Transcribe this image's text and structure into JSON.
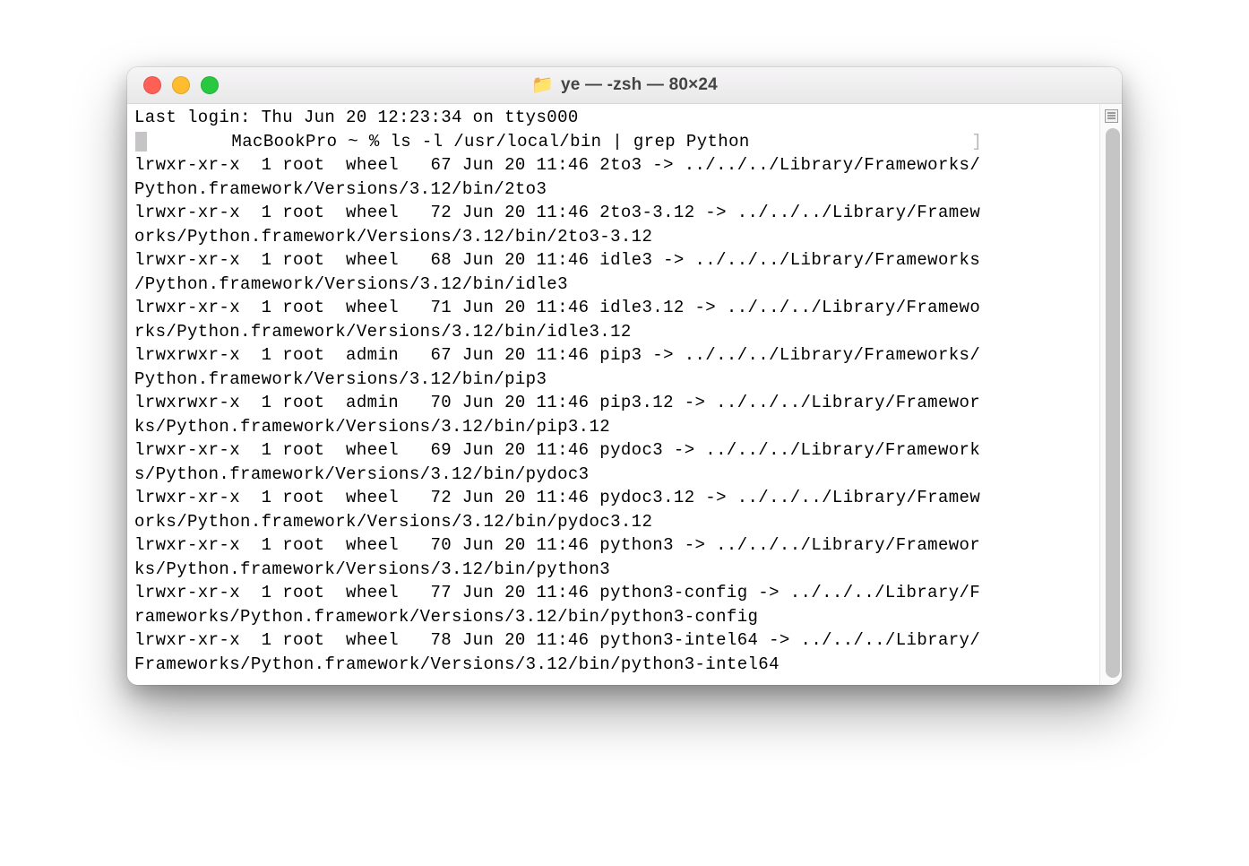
{
  "window": {
    "title": "ye — -zsh — 80×24",
    "folder_icon": "📁"
  },
  "terminal": {
    "last_login": "Last login: Thu Jun 20 12:23:34 on ttys000",
    "prompt_host": "MacBookPro ~ % ",
    "command": "ls -l /usr/local/bin | grep Python",
    "bracket": "]",
    "entries": [
      {
        "perm": "lrwxr-xr-x",
        "n": "1",
        "owner": "root",
        "group": "wheel",
        "size": "67",
        "date": "Jun 20 11:46",
        "name": "2to3",
        "target": "../../../Library/Frameworks/Python.framework/Versions/3.12/bin/2to3"
      },
      {
        "perm": "lrwxr-xr-x",
        "n": "1",
        "owner": "root",
        "group": "wheel",
        "size": "72",
        "date": "Jun 20 11:46",
        "name": "2to3-3.12",
        "target": "../../../Library/Frameworks/Python.framework/Versions/3.12/bin/2to3-3.12"
      },
      {
        "perm": "lrwxr-xr-x",
        "n": "1",
        "owner": "root",
        "group": "wheel",
        "size": "68",
        "date": "Jun 20 11:46",
        "name": "idle3",
        "target": "../../../Library/Frameworks/Python.framework/Versions/3.12/bin/idle3"
      },
      {
        "perm": "lrwxr-xr-x",
        "n": "1",
        "owner": "root",
        "group": "wheel",
        "size": "71",
        "date": "Jun 20 11:46",
        "name": "idle3.12",
        "target": "../../../Library/Frameworks/Python.framework/Versions/3.12/bin/idle3.12"
      },
      {
        "perm": "lrwxrwxr-x",
        "n": "1",
        "owner": "root",
        "group": "admin",
        "size": "67",
        "date": "Jun 20 11:46",
        "name": "pip3",
        "target": "../../../Library/Frameworks/Python.framework/Versions/3.12/bin/pip3"
      },
      {
        "perm": "lrwxrwxr-x",
        "n": "1",
        "owner": "root",
        "group": "admin",
        "size": "70",
        "date": "Jun 20 11:46",
        "name": "pip3.12",
        "target": "../../../Library/Frameworks/Python.framework/Versions/3.12/bin/pip3.12"
      },
      {
        "perm": "lrwxr-xr-x",
        "n": "1",
        "owner": "root",
        "group": "wheel",
        "size": "69",
        "date": "Jun 20 11:46",
        "name": "pydoc3",
        "target": "../../../Library/Frameworks/Python.framework/Versions/3.12/bin/pydoc3"
      },
      {
        "perm": "lrwxr-xr-x",
        "n": "1",
        "owner": "root",
        "group": "wheel",
        "size": "72",
        "date": "Jun 20 11:46",
        "name": "pydoc3.12",
        "target": "../../../Library/Frameworks/Python.framework/Versions/3.12/bin/pydoc3.12"
      },
      {
        "perm": "lrwxr-xr-x",
        "n": "1",
        "owner": "root",
        "group": "wheel",
        "size": "70",
        "date": "Jun 20 11:46",
        "name": "python3",
        "target": "../../../Library/Frameworks/Python.framework/Versions/3.12/bin/python3"
      },
      {
        "perm": "lrwxr-xr-x",
        "n": "1",
        "owner": "root",
        "group": "wheel",
        "size": "77",
        "date": "Jun 20 11:46",
        "name": "python3-config",
        "target": "../../../Library/Frameworks/Python.framework/Versions/3.12/bin/python3-config"
      },
      {
        "perm": "lrwxr-xr-x",
        "n": "1",
        "owner": "root",
        "group": "wheel",
        "size": "78",
        "date": "Jun 20 11:46",
        "name": "python3-intel64",
        "target": "../../../Library/Frameworks/Python.framework/Versions/3.12/bin/python3-intel64"
      }
    ]
  }
}
